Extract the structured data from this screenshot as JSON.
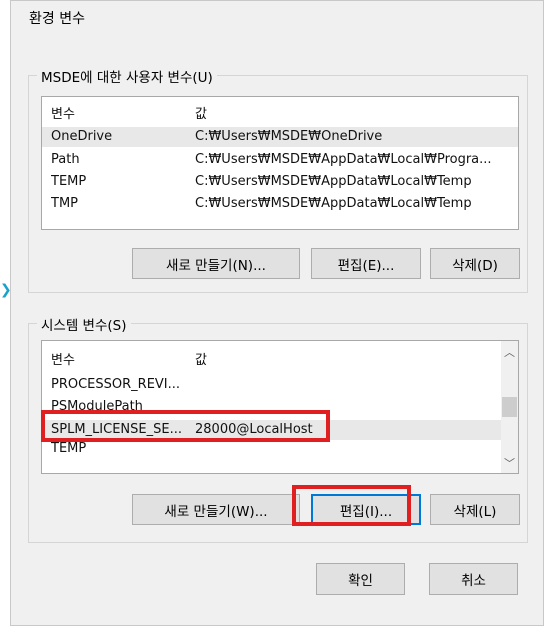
{
  "dialog": {
    "title": "환경 변수"
  },
  "user_vars": {
    "group_label": "MSDE에 대한 사용자 변수(U)",
    "columns": [
      "변수",
      "값"
    ],
    "rows": [
      {
        "name": "OneDrive",
        "value": "C:₩Users₩MSDE₩OneDrive"
      },
      {
        "name": "Path",
        "value": "C:₩Users₩MSDE₩AppData₩Local₩Progra..."
      },
      {
        "name": "TEMP",
        "value": "C:₩Users₩MSDE₩AppData₩Local₩Temp"
      },
      {
        "name": "TMP",
        "value": "C:₩Users₩MSDE₩AppData₩Local₩Temp"
      }
    ],
    "buttons": {
      "new": "새로 만들기(N)...",
      "edit": "편집(E)...",
      "delete": "삭제(D)"
    }
  },
  "system_vars": {
    "group_label": "시스템 변수(S)",
    "columns": [
      "변수",
      "값"
    ],
    "rows": [
      {
        "name": "PROCESSOR_REVI...",
        "value": ""
      },
      {
        "name": "PSModulePath",
        "value": ""
      },
      {
        "name": "SPLM_LICENSE_SE...",
        "value": "28000@LocalHost"
      },
      {
        "name": "TEMP",
        "value": ""
      }
    ],
    "buttons": {
      "new": "새로 만들기(W)...",
      "edit": "편집(I)...",
      "delete": "삭제(L)"
    }
  },
  "footer": {
    "ok": "확인",
    "cancel": "취소"
  },
  "icons": {
    "scroll_up": "chevron-up-icon",
    "scroll_down": "chevron-down-icon",
    "left_marker": "chevron-right-icon"
  },
  "colors": {
    "highlight": "#e02020",
    "accent": "#0078d7"
  }
}
